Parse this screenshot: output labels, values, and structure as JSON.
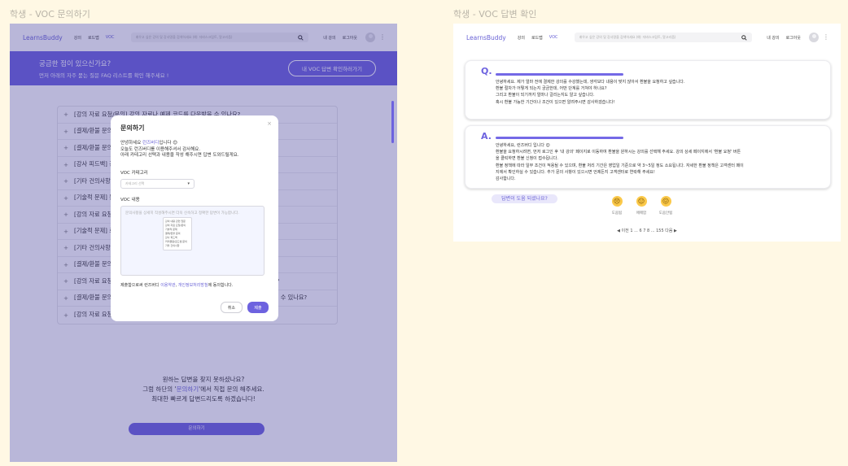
{
  "frames": {
    "left_title": "학생 - VOC 문의하기",
    "right_title": "학생 - VOC 답변 확인"
  },
  "nav": {
    "logo": "LearnsBuddy",
    "links": [
      "강의",
      "로드맵",
      "VOC"
    ],
    "search_placeholder": "배우고 싶은 강의 및 강사명을 검색하세요 (예: 자바스크립트, 알고리즘)",
    "my_lecture": "내 강의",
    "logout": "로그아웃"
  },
  "banner": {
    "title": "궁금한 점이 있으신가요?",
    "subtitle": "먼저 아래의 자주 묻는 질문 FAQ 리스트를 확인 해주세요 !",
    "button": "내 VOC 답변 확인하러가기"
  },
  "faq": [
    "[강의 자료 요청/문의] 강의 자료나 예제 코드를 다운받을 수 있나요?",
    "[결제/환불 문의] 결제가 완료되었는데 강의가 보이지 않나요?",
    "[결제/환불 문의] 환불 규정이 어떻게 되나요?",
    "[강사 피드백] 강사님께 질문을 남기면 답변이 오나요? 추가 강의를 계획 중인가요?",
    "[기타 건의사항] 모바일에서도 수강할 수 있나요? 오프라인 강의 계획이 있나요?",
    "[기술적 문제] 동영상이 재생되지 않아요.",
    "[강의 자료 요청/문의] 강의에서 사용된 라이브러리 버전을 알 수 있나요?",
    "[기술적 문제] 로그인이 되지 않아요.",
    "[기타 건의사항] 새로운 강의 주제를 제안하고 싶어요.",
    "[결제/환불 문의] 영수증 발급이 가능한가요?",
    "[강의 자료 요청/문의] 수강 기간이 끝난 후에도 자료를 받을 수 있나요? 가능한가요?",
    "[결제/환불 문의] 할인 쿠폰을 적용했는데 결제 금액이 다르게 나옵니다. 확인해 주실 수 있나요?",
    "[강의 자료 요청/문의] 강의 슬라이드와 예제 코드 자료를 추가로 받을 수 있을까요?"
  ],
  "cta": {
    "line1": "원하는 답변을 찾지 못하셨나요?",
    "line2_pre": "그럼 하단의 '",
    "line2_hl": "문의하기",
    "line2_post": "'에서 직접 문의 해주세요.",
    "line3": "최대한 빠르게 답변드리도록 하겠습니다!",
    "button": "문의하기"
  },
  "modal": {
    "title": "문의하기",
    "greet_pre": "안녕하세요 ",
    "greet_hl": "런즈버디",
    "greet_post": "입니다 😊",
    "line2": "오늘도 런즈버디를 이용해주셔서 감사해요.",
    "line3": "아래 카테고리 선택과 내용을 작성 해주시면 답변 도와드릴게요.",
    "category_label": "VOC 카테고리",
    "category_placeholder": "카테고리 선택",
    "category_options": [
      "강의 내용 관련 질문",
      "강의 자료 요청/문의",
      "기술적 문제",
      "결제/환불 문의",
      "강사 피드백",
      "커리큘럼/로드맵 문의",
      "기타 건의사항"
    ],
    "content_label": "VOC 내용",
    "content_placeholder": "문의사항을 상세히 작성해주시면 더욱 신속하고 정확한 답변이 가능합니다.",
    "consent_pre": "제출함으로써 런즈버디 ",
    "consent_terms": "이용약관",
    "consent_sep": ", ",
    "consent_privacy": "개인정보처리방침",
    "consent_post": "에 동의합니다.",
    "cancel": "취소",
    "submit": "제출"
  },
  "answer": {
    "q_mark": "Q.",
    "question": [
      "안녕하세요. 제가 얼마 전에 결제한 강의를 수강했는데, 생각보다 내용이 맞지 않아서 환불을 요청하고 싶습니다.",
      "환불 절차가 어떻게 되는지 궁금한데, 어떤 단계를 거쳐야 하나요?",
      "그리고 환불이 되기까지 얼마나 걸리는지도 알고 싶습니다.",
      "혹시 환불 가능한 기간이나 조건이 있으면 알려주시면 감사하겠습니다!"
    ],
    "a_mark": "A.",
    "reply": [
      "안녕하세요, 런즈버디 입니다 😊",
      "환불을 요청하시려면, 먼저 로그인 후 '내 강의' 페이지로 이동하여 환불을 원하시는 강의를 선택해 주세요. 강의 상세 페이지에서 '환불 요청' 버튼",
      "을 클릭하면 환불 신청이 접수됩니다.",
      "환불 정책에 따라 일부 조건이 적용될 수 있으며, 환불 처리 기간은 영업일 기준으로 약 3~5일 정도 소요됩니다. 자세한 환불 정책은 고객센터 페이",
      "지에서 확인하실 수 있습니다. 추가 문의 사항이 있으시면 언제든지 고객센터로 연락해 주세요!",
      "감사합니다."
    ],
    "helpful": "답변이 도움 되셨나요?",
    "feedback": [
      {
        "icon": "😣",
        "label": "도움됨"
      },
      {
        "icon": "😐",
        "label": "애매함"
      },
      {
        "icon": "😖",
        "label": "도움안됨"
      }
    ],
    "pager": "◀ 이전   1  ...  6  7  8  ...  155   다음 ▶"
  }
}
